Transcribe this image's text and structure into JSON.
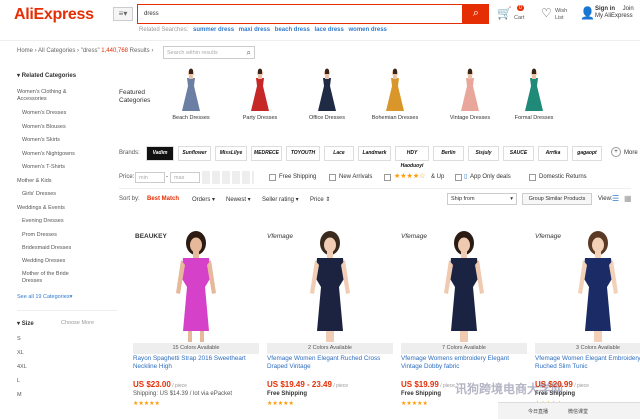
{
  "header": {
    "logo_main": "AliExpress",
    "search_value": "dress",
    "related_label": "Related Searches:",
    "related": [
      "summer dress",
      "maxi dress",
      "beach dress",
      "lace dress",
      "women dress"
    ],
    "cart_label": "Cart",
    "cart_count": "0",
    "wish_label_1": "Wish",
    "wish_label_2": "List",
    "signin_1": "Sign in",
    "signin_2": "Join",
    "signin_3": "My AliExpress"
  },
  "breadcrumb": {
    "path": "Home › All Categories › \"dress\"",
    "count": "1,440,768",
    "suffix": "Results ›",
    "within_placeholder": "Search within results"
  },
  "sidebar": {
    "related_title": "Related Categories",
    "items": [
      "Women's Clothing & Accessories",
      "Women's Dresses",
      "Women's Blouses",
      "Women's Skirts",
      "Women's Nightgowns",
      "Women's T-Shirts",
      "Mother & Kids",
      "Girls' Dresses",
      "Weddings & Events",
      "Evening Dresses",
      "Prom Dresses",
      "Bridesmaid Dresses",
      "Wedding Dresses",
      "Mother of the Bride Dresses"
    ],
    "see_all": "See all 19 Categories",
    "size_title": "Size",
    "size_more": "Choose More",
    "sizes": [
      "S",
      "XL",
      "4XL",
      "L",
      "M"
    ]
  },
  "featured": {
    "label": "Featured Categories",
    "items": [
      {
        "label": "Beach Dresses",
        "color": "#6b7fa5"
      },
      {
        "label": "Party Dresses",
        "color": "#c62828"
      },
      {
        "label": "Office Dresses",
        "color": "#1f2a44"
      },
      {
        "label": "Bohemian Dresses",
        "color": "#d9962b"
      },
      {
        "label": "Vintage Dresses",
        "color": "#e8a79a"
      },
      {
        "label": "Formal Dresses",
        "color": "#1f8a78"
      }
    ]
  },
  "brands": {
    "label": "Brands:",
    "items": [
      "Vadim",
      "Sunflower",
      "MissLilye",
      "MEDRECE",
      "TOYOUTH",
      "Lace",
      "Landmark",
      "HDY Haoduoyi",
      "Berlin",
      "Sisjuly",
      "SAUCE",
      "Arrtka",
      "gagaopt"
    ],
    "more": "More"
  },
  "filters": {
    "price_label": "Price:",
    "min": "min",
    "max": "max",
    "free_shipping": "Free Shipping",
    "new_arrivals": "New Arrivals",
    "up": "& Up",
    "app_only": "App Only deals",
    "domestic": "Domestic Returns"
  },
  "sort": {
    "label": "Sort by:",
    "best": "Best Match",
    "orders": "Orders ▾",
    "newest": "Newest ▾",
    "seller": "Seller rating ▾",
    "price": "Price ⇕",
    "ship_from": "Ship from",
    "group": "Group Similar Products",
    "view": "View:"
  },
  "products": [
    {
      "brand_tag": "BEAUKEY",
      "colors": "15 Colors Available",
      "title": "Rayon Spaghetti Strap 2016 Sweetheart Neckline High",
      "price": "US $23.00",
      "unit": "/ piece",
      "ship": "Shipping: US $14.39 / lot via ePacket",
      "dress_color": "#d641c9",
      "skin": "#e5b99a",
      "hair": "#2b1b13"
    },
    {
      "brand_tag": "Vfemage",
      "colors": "2 Colors Available",
      "title": "Vfemage Women Elegant Ruched Cross Draped Vintage",
      "price": "US $19.49 - 23.49",
      "unit": "/ piece",
      "ship": "Free Shipping",
      "dress_color": "#1c2340",
      "skin": "#f0cdb4",
      "hair": "#3b2a1e"
    },
    {
      "brand_tag": "Vfemage",
      "colors": "7 Colors Available",
      "title": "Vfemage Womens embroidery Elegant Vintage Dobby fabric",
      "price": "US $19.99",
      "unit": "/ piece",
      "ship": "Free Shipping",
      "dress_color": "#1b2342",
      "skin": "#efcab0",
      "hair": "#2a1c14"
    },
    {
      "brand_tag": "Vfemage",
      "colors": "3 Colors Available",
      "title": "Vfemage Women Elegant Embroidery Ruched Slim Tunic",
      "price": "US $20.99",
      "unit": "/ piece",
      "ship": "Free Shipping",
      "dress_color": "#1a2b66",
      "skin": "#f2d1b8",
      "hair": "#5a3a24"
    }
  ],
  "watermark": "讯狗跨境电商大学网",
  "bottombar": {
    "a": "今日直播",
    "b": "微信课堂"
  },
  "colors": {
    "accent": "#e62e04",
    "link": "#2e7bd0"
  }
}
